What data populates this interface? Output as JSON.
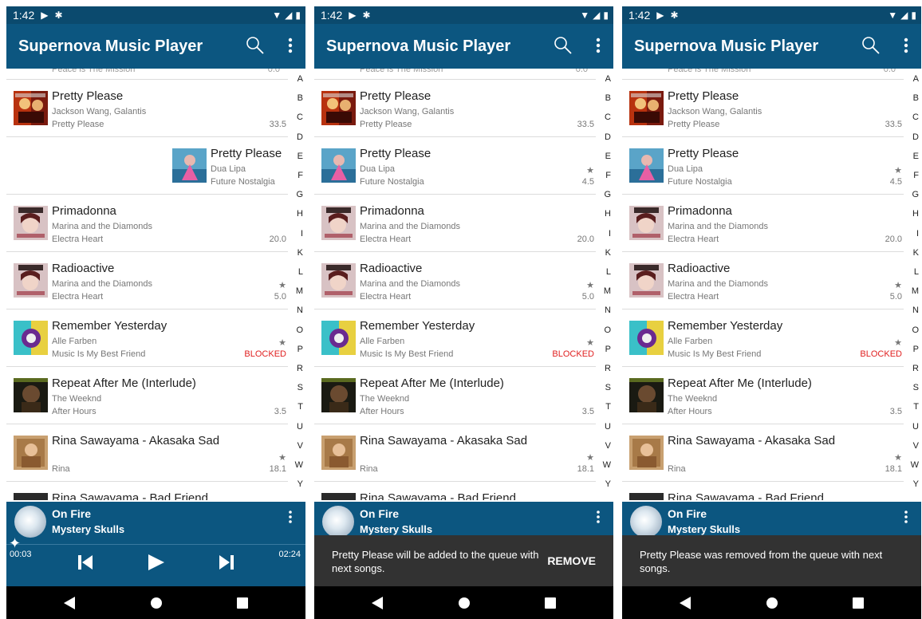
{
  "app": {
    "title": "Supernova Music Player"
  },
  "status": {
    "time": "1:42"
  },
  "top_partial": {
    "title": "Peace is The Mission",
    "value": "0.0"
  },
  "songs": [
    {
      "title": "Pretty Please",
      "artist": "Jackson Wang, Galantis",
      "album": "Pretty Please",
      "star": "",
      "value": "33.5"
    },
    {
      "title": "Pretty Please",
      "artist": "Dua Lipa",
      "album": "Future Nostalgia",
      "star": "★",
      "value": "4.5"
    },
    {
      "title": "Primadonna",
      "artist": "Marina and the Diamonds",
      "album": "Electra Heart",
      "star": "",
      "value": "20.0"
    },
    {
      "title": "Radioactive",
      "artist": "Marina and the Diamonds",
      "album": "Electra Heart",
      "star": "★",
      "value": "5.0"
    },
    {
      "title": "Remember Yesterday",
      "artist": "Alle Farben",
      "album": "Music Is My Best Friend",
      "star": "★",
      "value": "BLOCKED"
    },
    {
      "title": "Repeat After Me (Interlude)",
      "artist": "The Weeknd",
      "album": "After Hours",
      "star": "",
      "value": "3.5"
    },
    {
      "title": "Rina Sawayama - Akasaka Sad",
      "artist": "",
      "album": "Rina",
      "star": "★",
      "value": "18.1"
    },
    {
      "title": "Rina Sawayama - Bad Friend",
      "artist": "",
      "album": "",
      "star": "",
      "value": ""
    }
  ],
  "alphabet": [
    "A",
    "B",
    "C",
    "D",
    "E",
    "F",
    "G",
    "H",
    "I",
    "K",
    "L",
    "M",
    "N",
    "O",
    "P",
    "R",
    "S",
    "T",
    "U",
    "V",
    "W",
    "Y"
  ],
  "now_playing": {
    "title": "On Fire",
    "artist": "Mystery Skulls",
    "elapsed": "00:03",
    "duration": "02:24"
  },
  "screens": [
    {
      "mode": "player",
      "swiped_row": 1
    },
    {
      "mode": "snackbar",
      "message": "Pretty Please will be added to the queue with next songs.",
      "action": "REMOVE"
    },
    {
      "mode": "snackbar",
      "message": "Pretty Please was removed from the queue with next songs.",
      "action": ""
    }
  ],
  "icons": [
    "play-icon",
    "settings-icon",
    "wifi-icon",
    "signal-icon",
    "battery-icon",
    "search-icon",
    "more-vert-icon",
    "skip-previous-icon",
    "skip-next-icon",
    "back-icon",
    "home-icon",
    "recents-icon",
    "sparkle-icon"
  ],
  "colors": {
    "appbar": "#0c5680",
    "statusbar": "#0b4a6e",
    "blocked": "#e02020",
    "snackbar": "#323232"
  }
}
